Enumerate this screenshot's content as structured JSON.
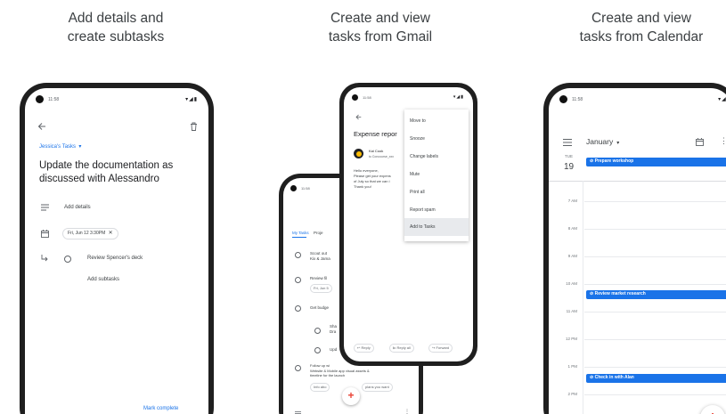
{
  "captions": [
    {
      "line1": "Add details and",
      "line2": "create subtasks"
    },
    {
      "line1": "Create and view",
      "line2": "tasks from Gmail"
    },
    {
      "line1": "Create and view",
      "line2": "tasks from Calendar"
    }
  ],
  "phone1": {
    "status_time": "11:58",
    "list_name": "Jessica's Tasks",
    "title_line1": "Update the documentation as",
    "title_line2": "discussed with Alessandro",
    "add_details": "Add details",
    "date_chip": "Fri, Jun 12  3:30PM",
    "subtask": "Review Spencer's deck",
    "add_subtasks": "Add subtasks",
    "mark_complete": "Mark complete"
  },
  "phone2_back": {
    "status_time": "11:58",
    "tab1": "My Tasks",
    "tab2": "Proje",
    "tasks": [
      {
        "line1": "Scout out",
        "line2": "Kix & Jama"
      },
      {
        "line1": "Review fil",
        "line2": ""
      },
      {
        "line1": "Get budge",
        "line2": ""
      },
      {
        "line1": "Sha",
        "line2": "Dra"
      },
      {
        "line1": "Upd",
        "line2": ""
      },
      {
        "line1": "Follow up wi",
        "line2": "Website & Mobile app visual assets &"
      }
    ],
    "task2_chip": "Fri, Jun 5",
    "task6_line3": "timeline for the launch",
    "chip_a": "Info abo",
    "chip_b": "plans you want",
    "fab": "+"
  },
  "phone2_front": {
    "status_time": "11:58",
    "subject": "Expense repor",
    "sender": "Kai Cook",
    "to_line": "to Concourse_xxx",
    "body_line1": "Hello everyone,",
    "body_line2": "Please get your expens",
    "body_line3": "of July so that we can i",
    "body_line4": "Thank you!",
    "reply": "Reply",
    "reply_all": "Reply all",
    "forward": "Forward",
    "menu": [
      "Move to",
      "Snooze",
      "Change labels",
      "Mute",
      "Print all",
      "Report spam",
      "Add to Tasks"
    ]
  },
  "phone3": {
    "status_time": "11:58",
    "month": "January",
    "day_name": "TUE",
    "day_num": "19",
    "allday_event": "Prepare workshop",
    "hours": [
      "7 AM",
      "8 AM",
      "9 AM",
      "10 AM",
      "11 AM",
      "12 PM",
      "1 PM",
      "2 PM"
    ],
    "event_10am": "Review market research",
    "event_1pm": "Check in with Alan"
  },
  "colors": {
    "accent": "#1a73e8",
    "frame": "#1f1f1f",
    "text": "#202124",
    "muted": "#5f6368",
    "fab_red": "#ea4335"
  }
}
